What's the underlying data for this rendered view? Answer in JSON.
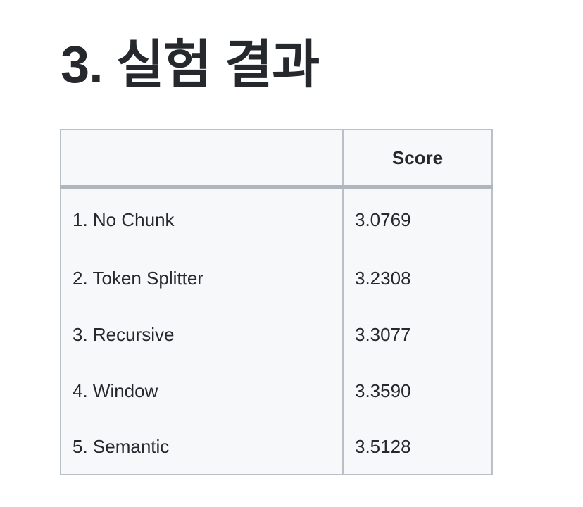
{
  "page": {
    "title": "3. 실험 결과"
  },
  "table": {
    "headers": [
      "",
      "Score"
    ],
    "rows": [
      {
        "label": "1. No Chunk",
        "score": "3.0769"
      },
      {
        "label": "2. Token Splitter",
        "score": "3.2308"
      },
      {
        "label": "3. Recursive",
        "score": "3.3077"
      },
      {
        "label": "4. Window",
        "score": "3.3590"
      },
      {
        "label": "5. Semantic",
        "score": "3.5128"
      }
    ]
  },
  "colors": {
    "text": "#25282c",
    "table_background": "#f6f8fa",
    "border": "#b9c0c8"
  }
}
